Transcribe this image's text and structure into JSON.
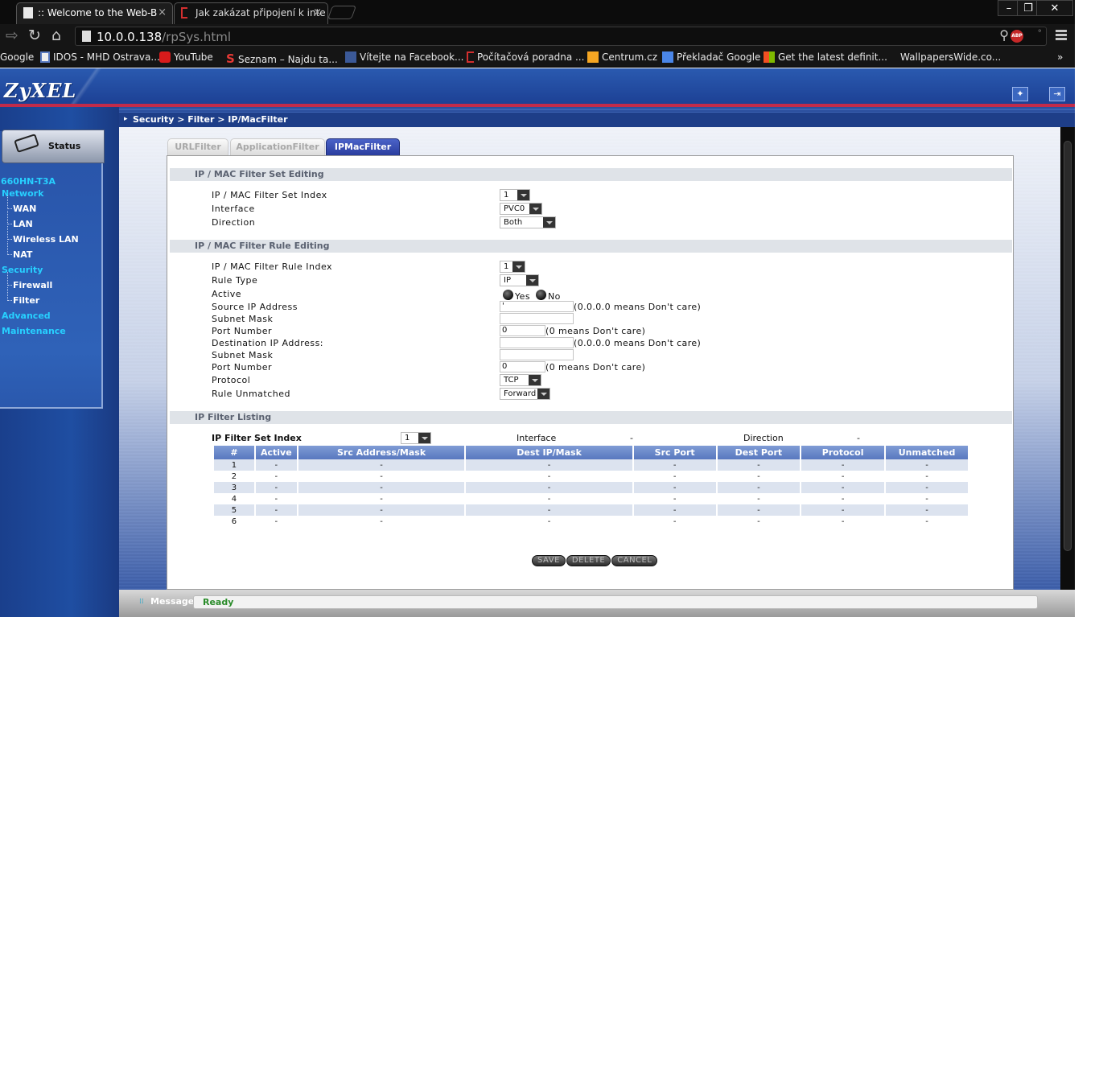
{
  "browser": {
    "tabs": [
      {
        "title": ":: Welcome to the Web-B",
        "active": true
      },
      {
        "title": "Jak zakázat připojení k inte",
        "active": false
      }
    ],
    "window_controls": [
      "–",
      "❐",
      "✕"
    ],
    "address": {
      "host": "10.0.0.138",
      "path": "/rpSys.html"
    },
    "extension_badge": "ABP",
    "bookmarks": [
      {
        "label": "Google",
        "icon": "google-icon"
      },
      {
        "label": "IDOS - MHD Ostrava...",
        "icon": "idos-icon"
      },
      {
        "label": "YouTube",
        "icon": "youtube-icon"
      },
      {
        "label": "Seznam – Najdu ta...",
        "icon": "seznam-icon"
      },
      {
        "label": "Vítejte na Facebook...",
        "icon": "facebook-icon"
      },
      {
        "label": "Počítačová poradna ...",
        "icon": "poradna-icon"
      },
      {
        "label": "Centrum.cz",
        "icon": "centrum-icon"
      },
      {
        "label": "Překladač Google",
        "icon": "translate-icon"
      },
      {
        "label": "Get the latest definit...",
        "icon": "windows-icon"
      },
      {
        "label": "WallpapersWide.co...",
        "icon": "wallpapers-icon"
      }
    ],
    "bookmarks_overflow": "»"
  },
  "router": {
    "logo": "ZyXEL",
    "breadcrumb": "Security > Filter > IP/MacFilter",
    "sidebar": {
      "status_label": "Status",
      "device": "660HN-T3A",
      "items": [
        {
          "label": "Network",
          "level": "top"
        },
        {
          "label": "WAN",
          "level": "sub"
        },
        {
          "label": "LAN",
          "level": "sub"
        },
        {
          "label": "Wireless LAN",
          "level": "sub"
        },
        {
          "label": "NAT",
          "level": "sub"
        },
        {
          "label": "Security",
          "level": "top"
        },
        {
          "label": "Firewall",
          "level": "sub"
        },
        {
          "label": "Filter",
          "level": "sub"
        },
        {
          "label": "Advanced",
          "level": "top"
        },
        {
          "label": "Maintenance",
          "level": "top"
        }
      ]
    },
    "subtabs": [
      {
        "label": "URLFilter",
        "active": false
      },
      {
        "label": "ApplicationFilter",
        "active": false
      },
      {
        "label": "IPMacFilter",
        "active": true
      }
    ],
    "set_editing": {
      "heading": "IP / MAC Filter Set Editing",
      "index_label": "IP / MAC Filter Set Index",
      "index_value": "1",
      "interface_label": "Interface",
      "interface_value": "PVC0",
      "direction_label": "Direction",
      "direction_value": "Both"
    },
    "rule_editing": {
      "heading": "IP / MAC Filter Rule Editing",
      "rule_index_label": "IP / MAC Filter Rule Index",
      "rule_index_value": "1",
      "rule_type_label": "Rule Type",
      "rule_type_value": "IP",
      "active_label": "Active",
      "active_yes": "Yes",
      "active_no": "No",
      "src_ip_label": "Source IP Address",
      "src_ip_value": "'",
      "src_ip_hint": "(0.0.0.0 means Don't care)",
      "src_mask_label": "Subnet Mask",
      "src_mask_value": "",
      "src_port_label": "Port Number",
      "src_port_value": "0",
      "src_port_hint": "(0 means Don't care)",
      "dst_ip_label": "Destination IP Address:",
      "dst_ip_value": "",
      "dst_ip_hint": "(0.0.0.0 means Don't care)",
      "dst_mask_label": "Subnet Mask",
      "dst_mask_value": "",
      "dst_port_label": "Port Number",
      "dst_port_value": "0",
      "dst_port_hint": "(0 means Don't care)",
      "protocol_label": "Protocol",
      "protocol_value": "TCP",
      "unmatched_label": "Rule Unmatched",
      "unmatched_value": "Forward"
    },
    "listing": {
      "heading": "IP Filter Listing",
      "set_index_label": "IP Filter Set Index",
      "set_index_value": "1",
      "interface_label": "Interface",
      "interface_value": "-",
      "direction_label": "Direction",
      "direction_value": "-",
      "columns": [
        "#",
        "Active",
        "Src Address/Mask",
        "Dest IP/Mask",
        "Src Port",
        "Dest Port",
        "Protocol",
        "Unmatched"
      ],
      "rows": [
        [
          "1",
          "-",
          "-",
          "-",
          "-",
          "-",
          "-",
          "-"
        ],
        [
          "2",
          "-",
          "-",
          "-",
          "-",
          "-",
          "-",
          "-"
        ],
        [
          "3",
          "-",
          "-",
          "-",
          "-",
          "-",
          "-",
          "-"
        ],
        [
          "4",
          "-",
          "-",
          "-",
          "-",
          "-",
          "-",
          "-"
        ],
        [
          "5",
          "-",
          "-",
          "-",
          "-",
          "-",
          "-",
          "-"
        ],
        [
          "6",
          "-",
          "-",
          "-",
          "-",
          "-",
          "-",
          "-"
        ]
      ]
    },
    "buttons": {
      "save": "SAVE",
      "delete": "DELETE",
      "cancel": "CANCEL"
    },
    "message": {
      "label": "Message",
      "text": "Ready"
    }
  }
}
